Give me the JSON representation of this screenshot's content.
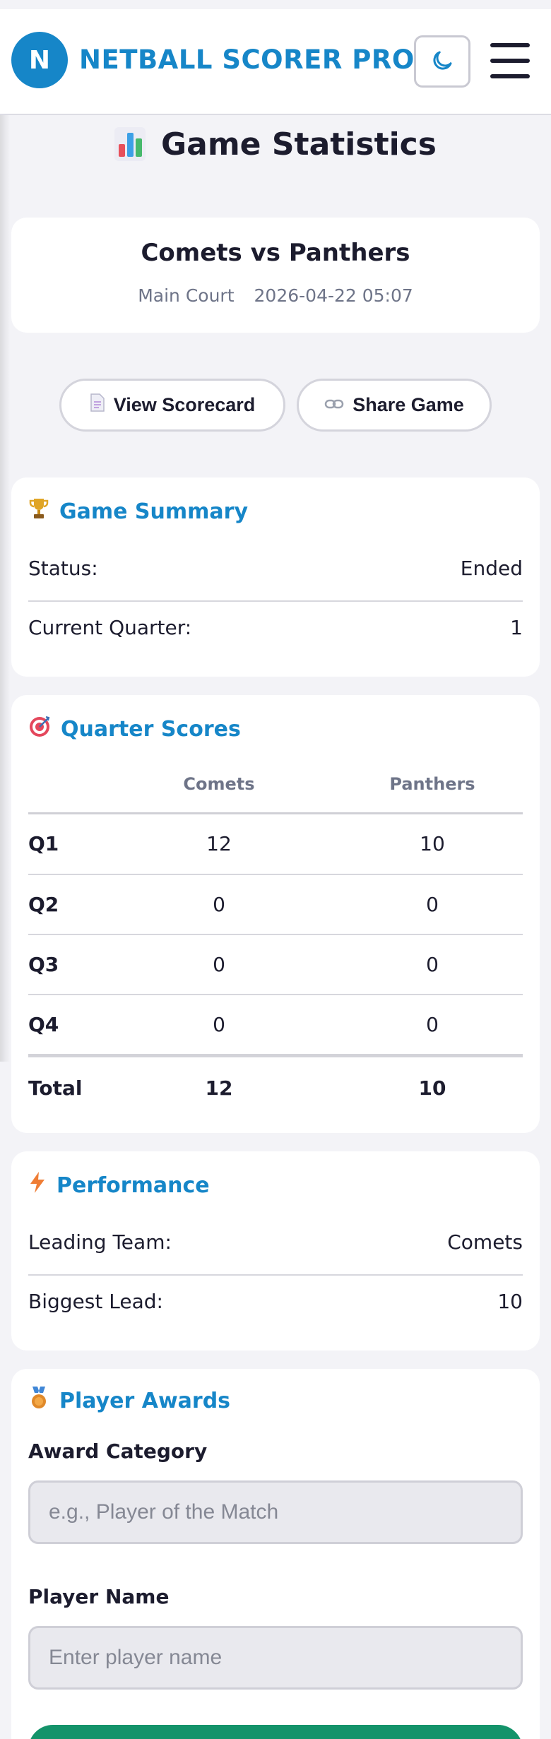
{
  "app": {
    "logo_letter": "N",
    "brand": "NETBALL SCORER PRO",
    "theme_icon": "moon-icon",
    "menu_icon": "hamburger-menu-icon"
  },
  "page": {
    "title": "Game Statistics",
    "title_icon": "bar-chart-emoji"
  },
  "match": {
    "title": "Comets vs Panthers",
    "venue": "Main Court",
    "datetime": "2026-04-22 05:07"
  },
  "actions": {
    "scorecard_label": "View Scorecard",
    "scorecard_icon": "document-icon",
    "share_label": "Share Game",
    "share_icon": "link-icon"
  },
  "summary": {
    "heading": "Game Summary",
    "icon": "trophy-icon",
    "status_label": "Status:",
    "status_value": "Ended",
    "quarter_label": "Current Quarter:",
    "quarter_value": "1"
  },
  "quarters": {
    "heading": "Quarter Scores",
    "icon": "target-icon",
    "team_a": "Comets",
    "team_b": "Panthers",
    "rows": [
      {
        "label": "Q1",
        "a": "12",
        "b": "10"
      },
      {
        "label": "Q2",
        "a": "0",
        "b": "0"
      },
      {
        "label": "Q3",
        "a": "0",
        "b": "0"
      },
      {
        "label": "Q4",
        "a": "0",
        "b": "0"
      }
    ],
    "total": {
      "label": "Total",
      "a": "12",
      "b": "10"
    }
  },
  "performance": {
    "heading": "Performance",
    "icon": "lightning-icon",
    "leading_label": "Leading Team:",
    "leading_value": "Comets",
    "lead_label": "Biggest Lead:",
    "lead_value": "10"
  },
  "awards": {
    "heading": "Player Awards",
    "icon": "medal-icon",
    "category_label": "Award Category",
    "category_placeholder": "e.g., Player of the Match",
    "player_label": "Player Name",
    "player_placeholder": "Enter player name"
  },
  "colors": {
    "accent": "#1686c8",
    "submit": "#14936a",
    "background": "#f3f3f7"
  }
}
